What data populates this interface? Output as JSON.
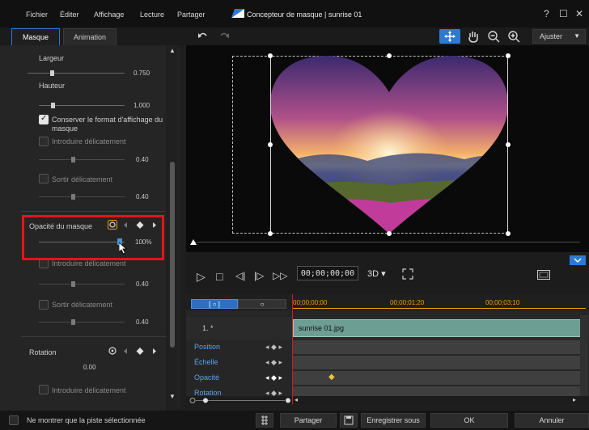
{
  "menu": [
    "Fichier",
    "Éditer",
    "Affichage",
    "Lecture",
    "Partager"
  ],
  "window_title": "Concepteur de masque | sunrise 01",
  "window_buttons": [
    "?",
    "☐",
    "✕"
  ],
  "tabs": [
    "Masque",
    "Animation"
  ],
  "left": {
    "largeur_label": "Largeur",
    "largeur_value": "0.750",
    "hauteur_label": "Hauteur",
    "hauteur_value": "1.000",
    "conserver_label": "Conserver le format d'affichage du masque",
    "introduire_label": "Introduire délicatement",
    "introduire_value": "0.40",
    "sortir_label": "Sortir délicatement",
    "sortir_value": "0.40",
    "opacite_label": "Opacité du masque",
    "opacite_value": "100%",
    "introduire2_label": "Introduire délicatement",
    "introduire2_value": "0.40",
    "sortir2_label": "Sortir délicatement",
    "sortir2_value": "0.40",
    "rotation_label": "Rotation",
    "rotation_value": "0.00",
    "introduire3_label": "Introduire délicatement"
  },
  "toolbar": {
    "ajuster": "Ajuster"
  },
  "transport": {
    "timecode": "00;00;00;00",
    "mode": "3D"
  },
  "timeline": {
    "btn1": "[ ○ ]",
    "btn2": "○",
    "ticks": [
      "00;00;00;00",
      "00;00;01;20",
      "00;00;03;10"
    ],
    "track_label": "1. *",
    "clip_name": "sunrise 01.jpg",
    "props": [
      "Position",
      "Échelle",
      "Opacité",
      "Rotation"
    ]
  },
  "bottom": {
    "only_selected": "Ne montrer que la piste sélectionnée",
    "partager": "Partager",
    "enregistrer": "Enregistrer sous",
    "ok": "OK",
    "annuler": "Annuler"
  },
  "colors": {
    "accent": "#2e7ad1",
    "highlight": "#e3151a",
    "clip": "#6d9e93",
    "timecode": "#f0a000"
  }
}
